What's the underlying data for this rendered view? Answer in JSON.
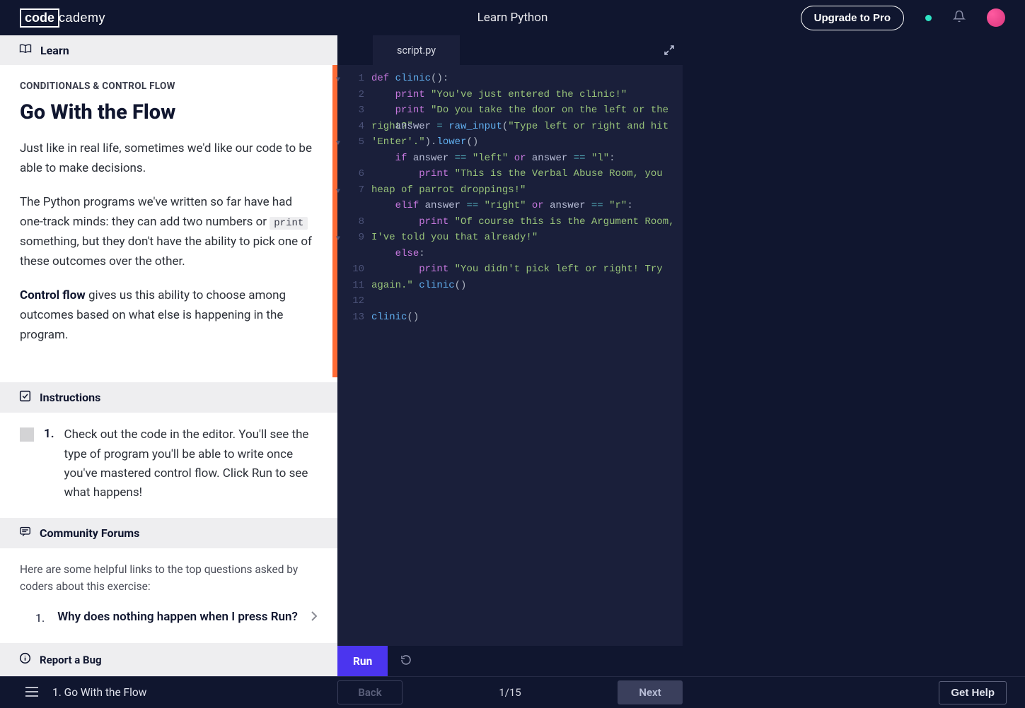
{
  "nav": {
    "course_title": "Learn Python",
    "upgrade_label": "Upgrade to Pro"
  },
  "lesson": {
    "learn_tab": "Learn",
    "breadcrumb": "CONDITIONALS & CONTROL FLOW",
    "title": "Go With the Flow",
    "p1": "Just like in real life, sometimes we'd like our code to be able to make decisions.",
    "p2_pre": "The Python programs we've written so far have had one-track minds: they can add two numbers or ",
    "p2_chip": "print",
    "p2_post": " something, but they don't have the ability to pick one of these outcomes over the other.",
    "p3_strong": "Control flow",
    "p3_rest": " gives us this ability to choose among outcomes based on what else is happening in the program.",
    "instructions_header": "Instructions",
    "instruction_num": "1.",
    "instruction_text": "Check out the code in the editor. You'll see the type of program you'll be able to write once you've mastered control flow. Click Run to see what happens!",
    "forums_header": "Community Forums",
    "forums_intro": "Here are some helpful links to the top questions asked by coders about this exercise:",
    "forum_item_num": "1.",
    "forum_item_text": "Why does nothing happen when I press Run?",
    "bug_label": "Report a Bug"
  },
  "editor": {
    "filename": "script.py",
    "run_label": "Run"
  },
  "bottom": {
    "lesson_label": "1. Go With the Flow",
    "back_label": "Back",
    "next_label": "Next",
    "progress": "1/15",
    "help_label": "Get Help"
  }
}
